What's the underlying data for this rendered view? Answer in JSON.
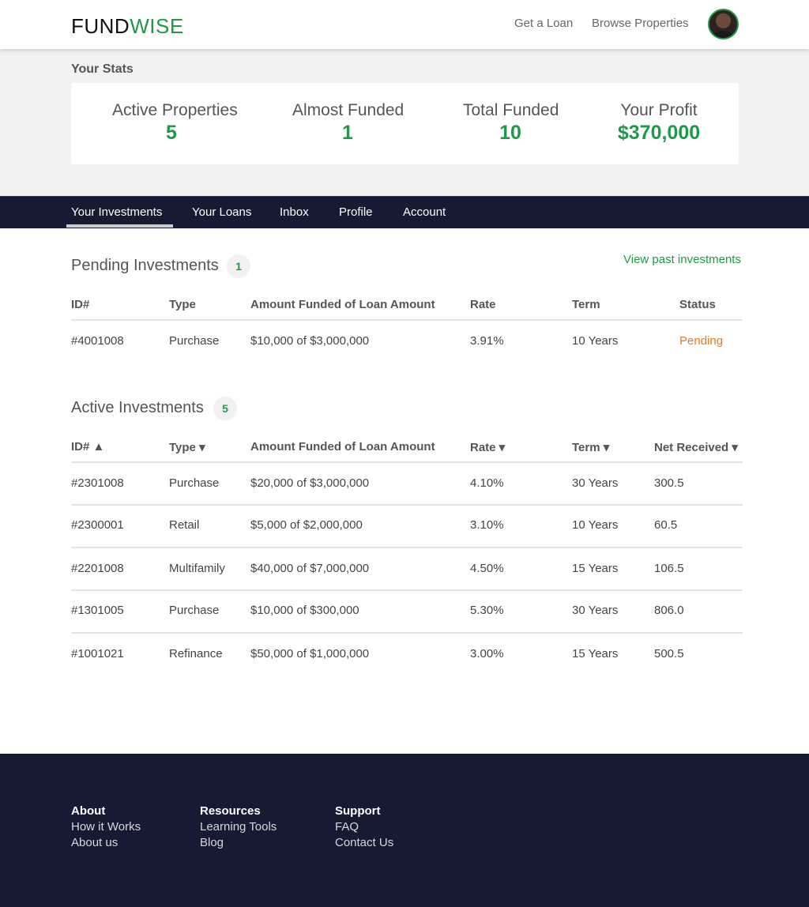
{
  "header": {
    "logo_part1": "FUND",
    "logo_part2": "WISE",
    "nav": [
      "Get a Loan",
      "Browse Properties"
    ],
    "avatar_alt": "user avatar"
  },
  "stats": {
    "title": "Your Stats",
    "items": [
      {
        "label": "Active Properties",
        "value": "5"
      },
      {
        "label": "Almost Funded",
        "value": "1"
      },
      {
        "label": "Total Funded",
        "value": "10"
      },
      {
        "label": "Your Profit",
        "value": "$370,000"
      }
    ]
  },
  "tabs": {
    "items": [
      "Your Investments",
      "Your Loans",
      "Inbox",
      "Profile",
      "Account"
    ],
    "active": "Your Investments"
  },
  "pending": {
    "title": "Pending Investments",
    "count": "1",
    "view_past": "View past investments",
    "headers": [
      "ID#",
      "Type",
      "Amount Funded of Loan Amount",
      "Rate",
      "Term",
      "Status"
    ],
    "rows": [
      [
        "#4001008",
        "Purchase",
        "$10,000 of $3,000,000",
        "3.91%",
        "10 Years",
        "Pending"
      ]
    ]
  },
  "active": {
    "title": "Active Investments",
    "count": "5",
    "headers": [
      "ID# ▲",
      "Type ▾",
      "Amount Funded of Loan Amount",
      "Rate ▾",
      "Term ▾",
      "Net Received ▾"
    ],
    "rows": [
      [
        "#2301008",
        "Purchase",
        "$20,000 of $3,000,000",
        "4.10%",
        "30 Years",
        "300.5"
      ],
      [
        "#2300001",
        "Retail",
        "$5,000 of $2,000,000",
        "3.10%",
        "10 Years",
        "60.5"
      ],
      [
        "#2201008",
        "Multifamily",
        "$40,000 of $7,000,000",
        "4.50%",
        "15 Years",
        "106.5"
      ],
      [
        "#1301005",
        "Purchase",
        "$10,000 of $300,000",
        "5.30%",
        "30 Years",
        "806.0"
      ],
      [
        "#1001021",
        "Refinance",
        "$50,000 of $1,000,000",
        "3.00%",
        "15 Years",
        "500.5"
      ]
    ]
  },
  "footer": {
    "columns": [
      {
        "heading": "About",
        "links": [
          "How it Works",
          "About us"
        ]
      },
      {
        "heading": "Resources",
        "links": [
          "Learning Tools",
          "Blog"
        ]
      },
      {
        "heading": "Support",
        "links": [
          "FAQ",
          "Contact Us"
        ]
      }
    ]
  },
  "colors": {
    "brand_green": "#1e9a47",
    "navy": "#161b33",
    "pending_orange": "#e07d23"
  }
}
